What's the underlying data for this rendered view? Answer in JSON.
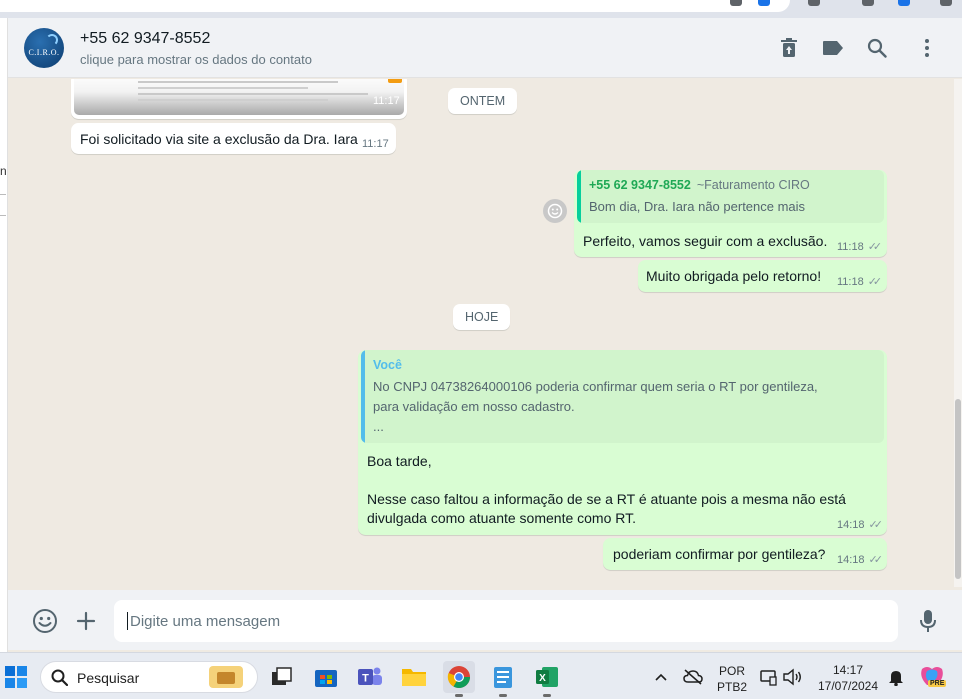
{
  "header": {
    "contact_name": "+55 62 9347-8552",
    "contact_subtitle": "clique para mostrar os dados do contato",
    "avatar_text": "C.I.R.O.",
    "icons": [
      "delete-icon",
      "label-icon",
      "search-icon",
      "menu-icon"
    ]
  },
  "chat": {
    "attachment_time": "11:17",
    "msg1": {
      "text": "Foi solicitado via site a exclusão da Dra. Iara",
      "time": "11:17"
    },
    "date_yesterday": "ONTEM",
    "reply1": {
      "quote_name": "+55 62 9347-8552",
      "quote_tag": "~Faturamento CIRO",
      "quote_text": "Bom dia, Dra. Iara não pertence mais",
      "text": "Perfeito, vamos seguir com a exclusão.",
      "time": "11:18"
    },
    "msg3": {
      "text": "Muito obrigada pelo retorno!",
      "time": "11:18"
    },
    "date_today": "HOJE",
    "reply2": {
      "quote_name": "Você",
      "quote_line1": "No CNPJ 04738264000106 poderia confirmar quem seria o RT por gentileza,",
      "quote_line2": "para validação em nosso cadastro.",
      "quote_line3": "...",
      "line1": "Boa tarde,",
      "line2": "Nesse caso faltou a informação de se a RT é atuante pois a mesma não está",
      "line3": "divulgada como atuante somente como RT.",
      "time": "14:18"
    },
    "msg5": {
      "text": "poderiam confirmar por gentileza?",
      "time": "14:18"
    }
  },
  "composer": {
    "placeholder": "Digite uma mensagem"
  },
  "taskbar": {
    "search_label": "Pesquisar",
    "lang_top": "POR",
    "lang_bottom": "PTB2",
    "clock_time": "14:17",
    "clock_date": "17/07/2024",
    "pre_badge": "PRE"
  },
  "colors": {
    "outgoing_bubble": "#d9fdd3",
    "incoming_bubble": "#ffffff",
    "chat_background": "#efeae2",
    "quote_accent_contact": "#06cf9c",
    "quote_accent_you": "#53bdeb",
    "quote_name_contact": "#1fa855",
    "quote_name_you": "#53bdeb"
  }
}
